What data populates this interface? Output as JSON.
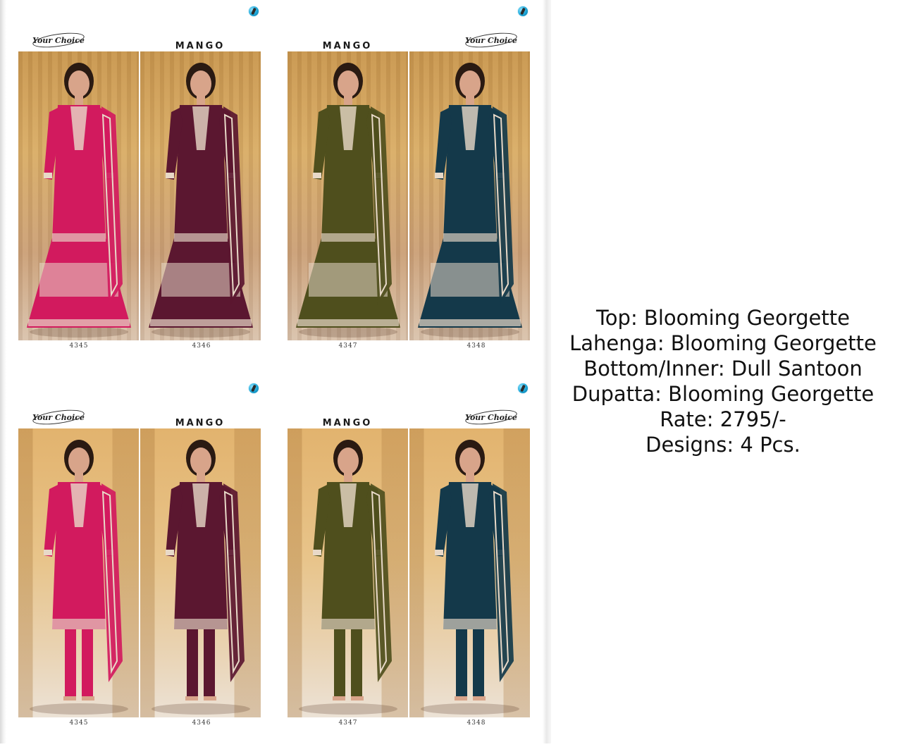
{
  "catalog": {
    "brand": "Your Choice",
    "collection": "MANGO",
    "pages": [
      {
        "style": "lahenga",
        "panels": [
          {
            "design_no": "4345",
            "color": "#d21a5e"
          },
          {
            "design_no": "4346",
            "color": "#5b1730"
          }
        ]
      },
      {
        "style": "lahenga",
        "panels": [
          {
            "design_no": "4347",
            "color": "#4f4f1d"
          },
          {
            "design_no": "4348",
            "color": "#14394a"
          }
        ]
      },
      {
        "style": "suit",
        "panels": [
          {
            "design_no": "4345",
            "color": "#d21a5e"
          },
          {
            "design_no": "4346",
            "color": "#5b1730"
          }
        ]
      },
      {
        "style": "suit",
        "panels": [
          {
            "design_no": "4347",
            "color": "#4f4f1d"
          },
          {
            "design_no": "4348",
            "color": "#14394a"
          }
        ]
      }
    ]
  },
  "specs": {
    "top": "Top: Blooming Georgette",
    "lahenga": "Lahenga: Blooming Georgette",
    "bottom": "Bottom/Inner: Dull Santoon",
    "dupatta": "Dupatta: Blooming Georgette",
    "rate": "Rate: 2795/-",
    "designs": "Designs: 4 Pcs."
  },
  "colors": {
    "background": "#ffffff",
    "text": "#111111",
    "embroidery": "#e8d9c8",
    "skin": "#d8a48a",
    "hair": "#2a1a12"
  }
}
